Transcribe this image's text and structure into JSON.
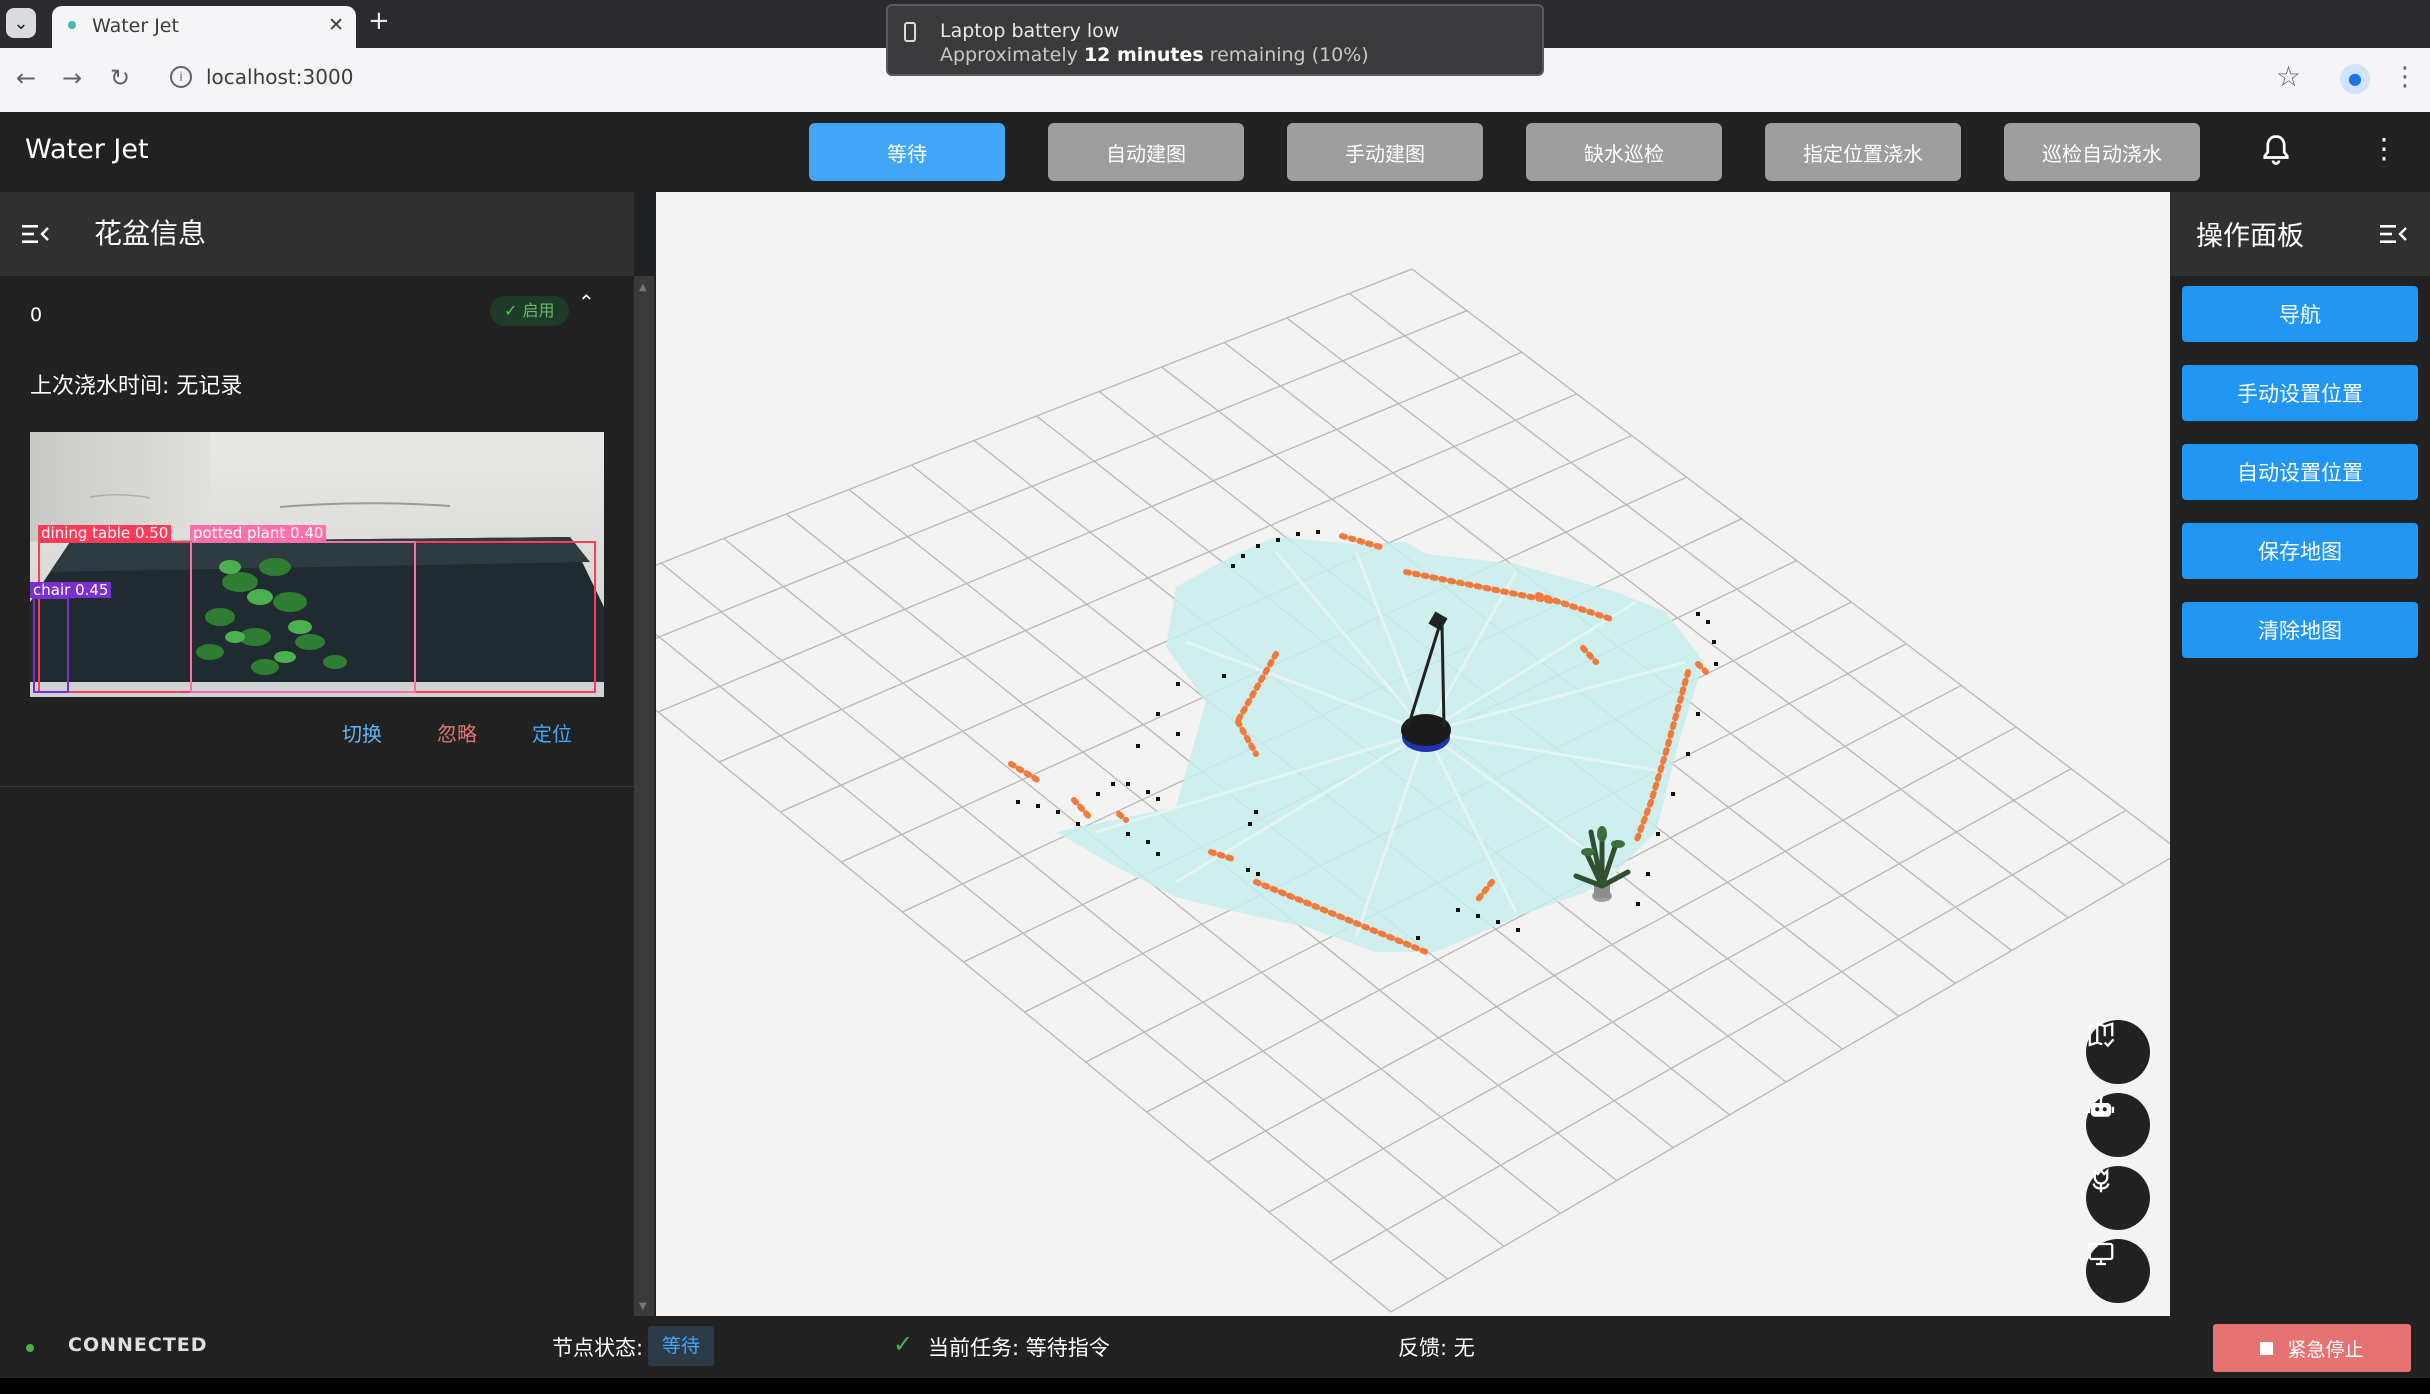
{
  "browser": {
    "tab_title": "Water Jet",
    "url": "localhost:3000",
    "notification": {
      "title": "Laptop battery low",
      "text_prefix": "Approximately ",
      "text_bold": "12 minutes",
      "text_suffix": " remaining (10%)"
    }
  },
  "app": {
    "title": "Water Jet",
    "modes": [
      "等待",
      "自动建图",
      "手动建图",
      "缺水巡检",
      "指定位置浇水",
      "巡检自动浇水"
    ],
    "active_mode": "等待"
  },
  "left_panel": {
    "title": "花盆信息",
    "pot": {
      "id": "0",
      "status": "启用",
      "last_watering": "上次浇水时间: 无记录",
      "detections": [
        {
          "label": "dining table",
          "score": "0.50",
          "color": "#ff3b5c"
        },
        {
          "label": "potted plant",
          "score": "0.40",
          "color": "#ff6fa8"
        },
        {
          "label": "chair",
          "score": "0.45",
          "color": "#7b2fd1"
        }
      ],
      "actions": [
        {
          "label": "切换",
          "color": "#64b5f6"
        },
        {
          "label": "忽略",
          "color": "#e57373"
        },
        {
          "label": "定位",
          "color": "#42a5f5"
        }
      ]
    }
  },
  "right_panel": {
    "title": "操作面板",
    "buttons": [
      "导航",
      "手动设置位置",
      "自动设置位置",
      "保存地图",
      "清除地图"
    ]
  },
  "viewer": {
    "fab_icons": [
      "map-check-icon",
      "robot-icon",
      "flower-icon",
      "monitor-icon"
    ]
  },
  "status": {
    "connection": "CONNECTED",
    "node_state_label": "节点状态:",
    "node_state": "等待",
    "current_task": "当前任务:  等待指令",
    "feedback": "反馈:  无",
    "estop_label": "紧急停止"
  }
}
